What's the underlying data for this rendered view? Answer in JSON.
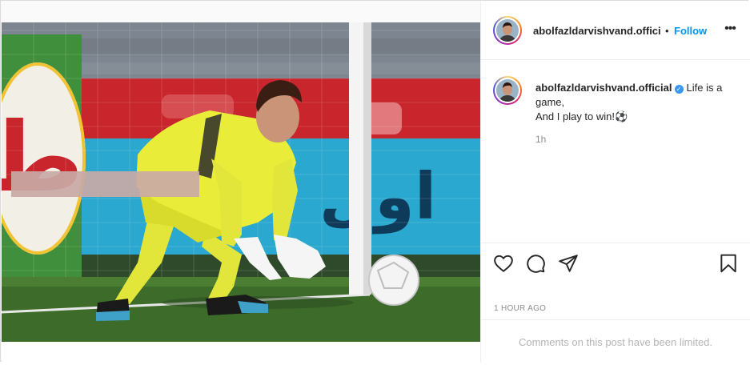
{
  "post": {
    "media": {
      "description_icon": "photo-image",
      "sponsor_banner_text": "اول",
      "pitch_logo_text": "ط"
    },
    "header": {
      "username": "abolfazldarvishvand.offici",
      "separator": "•",
      "follow_label": "Follow",
      "more_icon": "•••"
    },
    "caption": {
      "username": "abolfazldarvishvand.official",
      "verified_icon": "✓",
      "text_line1": "Life is a game,",
      "text_line2": "And I play to win!",
      "emoji": "⚽",
      "time": "1h"
    },
    "actions": {
      "like_icon": "heart-icon",
      "comment_icon": "comment-icon",
      "share_icon": "paper-plane-icon",
      "save_icon": "bookmark-icon"
    },
    "timestamp": "1 hour ago",
    "comments_limited": "Comments on this post have been limited."
  }
}
